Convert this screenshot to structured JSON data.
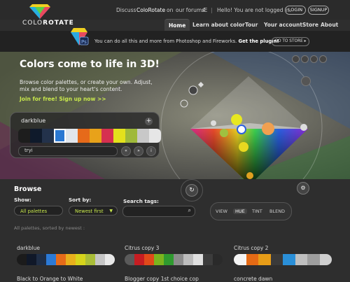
{
  "header": {
    "logo_text_a": "COLO",
    "logo_text_b": "ROTATE",
    "discuss": "Discuss",
    "colorotate": "ColoRotate",
    "on": "on",
    "forums": "our forums",
    "forums_marker": "Æ",
    "separator": "|",
    "hello": "Hello! You are not logged in.",
    "login": "LOGIN",
    "signup": "SIGNUP"
  },
  "nav": {
    "items": [
      "Home",
      "Learn about color",
      "Tour",
      "Your account",
      "Store",
      "About"
    ],
    "active": "Home"
  },
  "promo": {
    "text": "You can do all this and more from Photoshop and Fireworks.",
    "cta": "Get the plugin!",
    "store_button": "GO TO STORE ▸"
  },
  "hero": {
    "title": "Colors come to life in 3D!",
    "subtitle": "Browse color palettes, or create your own. Adjust, mix and blend to your heart's content.",
    "join": "Join for free! Sign up now >>"
  },
  "palette_editor": {
    "name": "darkblue",
    "plus": "+",
    "input_value": "tryi",
    "tools": [
      "«",
      "»",
      "i"
    ],
    "swatches": [
      "#1d1d1d",
      "#0f1a2b",
      "#23324b",
      "#2a78d2",
      "#e1e6ec",
      "#e66a1a",
      "#e8a21a",
      "#d63050",
      "#e3e11c",
      "#9fb93a",
      "#c8c8c8",
      "#e6e6e6"
    ],
    "selected_index": 3
  },
  "browse": {
    "title": "Browse",
    "show_label": "Show:",
    "show_value": "All palettes",
    "sort_label": "Sort by:",
    "sort_value": "Newest first",
    "search_label": "Search tags:",
    "search_placeholder": "",
    "views": [
      "VIEW",
      "HUE",
      "TINT",
      "BLEND"
    ],
    "active_view": "HUE",
    "sorted_note": "All palettes, sorted by newest :"
  },
  "palettes": [
    {
      "name": "darkblue",
      "colors": [
        "#1b1b1b",
        "#101828",
        "#1f2e46",
        "#2c7ad6",
        "#e66b19",
        "#e8b01c",
        "#d6d41b",
        "#a9bd38",
        "#c5c5c5",
        "#e8e8e8"
      ]
    },
    {
      "name": "Citrus copy 3",
      "colors": [
        "#5a5a5a",
        "#c61d22",
        "#e04a1a",
        "#7cb41e",
        "#2f9a2f",
        "#8c8c8c",
        "#bdbdbd",
        "#e0e0e0",
        "#3c3c3c",
        "#2a2a2a"
      ]
    },
    {
      "name": "Citrus copy 2",
      "colors": [
        "#f4f4f4",
        "#e46a15",
        "#e79d18",
        "#3a3a3a",
        "#2a8fd8",
        "#bfbfbf",
        "#9e9e9e",
        "#cfcfcf"
      ]
    }
  ],
  "palettes_row2": [
    "Black to Orange to White",
    "Blogger copy 1st choice cop",
    "concrete dawn"
  ],
  "icons": {
    "search": "search-icon",
    "rotate": "rotate-icon",
    "settings": "settings-icon",
    "bulb": "bulb-icon"
  }
}
